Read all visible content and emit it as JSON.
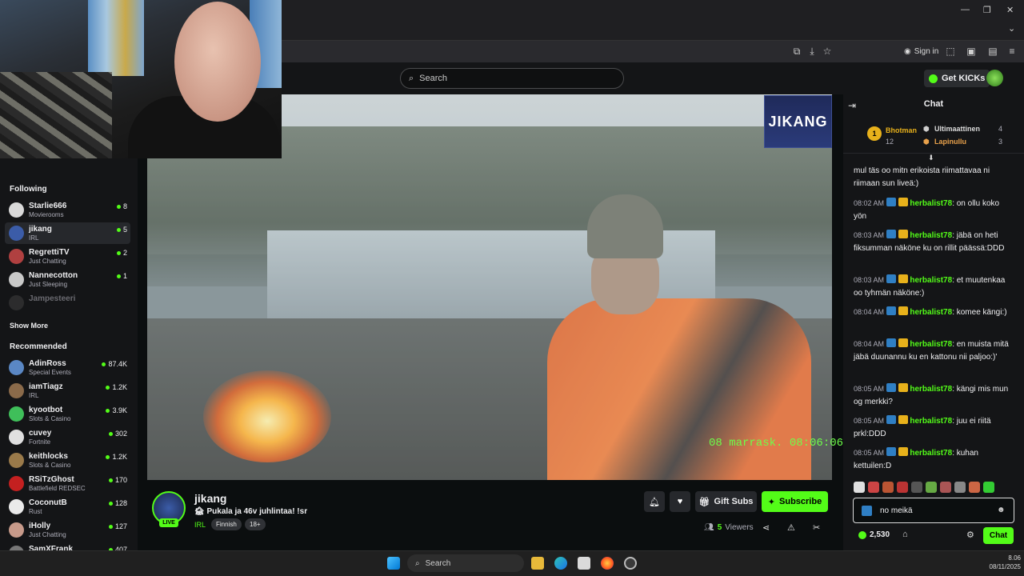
{
  "browser": {
    "sign_in": "Sign in"
  },
  "site": {
    "search_placeholder": "Search",
    "get_kicks": "Get KICKs"
  },
  "sidebar": {
    "following_title": "Following",
    "following": [
      {
        "name": "Starlie666",
        "category": "Movierooms",
        "viewers": "8",
        "avatar_color": "#d9d9d9",
        "live": true
      },
      {
        "name": "jikang",
        "category": "IRL",
        "viewers": "5",
        "avatar_color": "#3b5ca8",
        "live": true,
        "active": true
      },
      {
        "name": "RegrettiTV",
        "category": "Just Chatting",
        "viewers": "2",
        "avatar_color": "#b04040",
        "live": true
      },
      {
        "name": "Nannecotton",
        "category": "Just Sleeping",
        "viewers": "1",
        "avatar_color": "#c9c9c9",
        "live": true
      },
      {
        "name": "Jampesteeri",
        "category": "",
        "viewers": "",
        "avatar_color": "#444444",
        "live": false
      }
    ],
    "show_more": "Show More",
    "recommended_title": "Recommended",
    "recommended": [
      {
        "name": "AdinRoss",
        "category": "Special Events",
        "viewers": "87.4K",
        "avatar_color": "#5a87c4"
      },
      {
        "name": "iamTiagz",
        "category": "IRL",
        "viewers": "1.2K",
        "avatar_color": "#8a6a4a"
      },
      {
        "name": "kyootbot",
        "category": "Slots & Casino",
        "viewers": "3.9K",
        "avatar_color": "#3fbf5a"
      },
      {
        "name": "cuvey",
        "category": "Fortnite",
        "viewers": "302",
        "avatar_color": "#e0e0e0"
      },
      {
        "name": "keithlocks",
        "category": "Slots & Casino",
        "viewers": "1.2K",
        "avatar_color": "#9a7a4a"
      },
      {
        "name": "RSiTzGhost",
        "category": "Battlefield REDSEC",
        "viewers": "170",
        "avatar_color": "#c42020"
      },
      {
        "name": "CoconutB",
        "category": "Rust",
        "viewers": "128",
        "avatar_color": "#eaeaea"
      },
      {
        "name": "iHolly",
        "category": "Just Chatting",
        "viewers": "127",
        "avatar_color": "#c79a8a"
      },
      {
        "name": "SamXFrank",
        "category": "",
        "viewers": "407",
        "avatar_color": "#777777"
      }
    ]
  },
  "video": {
    "overlay_timestamp": "08 marrask. 08:06:06",
    "logo_text": "JIKANG"
  },
  "stream": {
    "streamer": "jikang",
    "live_label": "LIVE",
    "title": "🏚 Pukala ja 46v juhlintaa! !sr",
    "category": "IRL",
    "tags": [
      "Finnish",
      "18+"
    ],
    "gift_subs": "Gift Subs",
    "subscribe": "Subscribe",
    "viewers_count": "5",
    "viewers_label": "Viewers"
  },
  "chat": {
    "header": "Chat",
    "leaderboard": {
      "first": {
        "rank": "1",
        "name": "Bhotman",
        "count": "12"
      },
      "others": [
        {
          "name": "Ultimaattinen",
          "count": "4"
        },
        {
          "name": "Lapinullu",
          "count": "3"
        }
      ]
    },
    "partial_message": "mul täs oo mitn erikoista riimattavaa ni riimaan sun liveä:)",
    "messages": [
      {
        "time": "08:02 AM",
        "user": "herbalist78",
        "text": "on ollu koko yön"
      },
      {
        "time": "08:03 AM",
        "user": "herbalist78",
        "text": "jäbä on heti fiksumman näköne ku on rillit päässä:DDD"
      },
      {
        "time": "08:03 AM",
        "user": "herbalist78",
        "text": "et muutenkaa oo tyhmän näköne:)"
      },
      {
        "time": "08:04 AM",
        "user": "herbalist78",
        "text": "komee kängi:)"
      },
      {
        "time": "08:04 AM",
        "user": "herbalist78",
        "text": "en muista mitä jäbä duunannu ku en kattonu nii paljoo:)'"
      },
      {
        "time": "08:05 AM",
        "user": "herbalist78",
        "text": "kängi mis mun og merkki?"
      },
      {
        "time": "08:05 AM",
        "user": "herbalist78",
        "text": "juu ei riitä prkl:DDD"
      },
      {
        "time": "08:05 AM",
        "user": "herbalist78",
        "text": "kuhan kettuilen:D"
      }
    ],
    "input_value": "no meikä",
    "kicks_balance": "2,530",
    "chat_button": "Chat"
  },
  "taskbar": {
    "search": "Search",
    "time": "8.06",
    "date": "08/11/2025"
  },
  "colors": {
    "accent": "#53fc18",
    "background": "#0b0e0f",
    "panel": "#141517"
  }
}
